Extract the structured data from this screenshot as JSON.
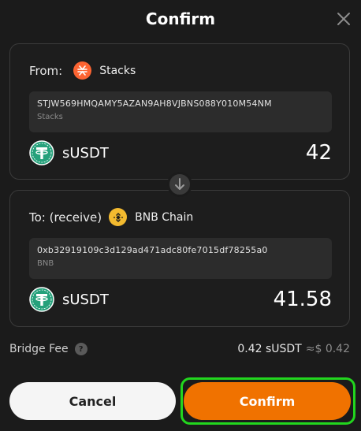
{
  "dialog": {
    "title": "Confirm"
  },
  "from": {
    "label": "From:",
    "chain": "Stacks",
    "chain_color": "#fc6432",
    "address": "STJW569HMQAMY5AZAN9AH8VJBNS088Y010M54NM",
    "network": "Stacks",
    "token": "sUSDT",
    "amount": "42"
  },
  "to": {
    "label": "To: (receive)",
    "chain": "BNB Chain",
    "chain_color": "#f3ba2f",
    "address": "0xb32919109c3d129ad471adc80fe7015df78255a0",
    "network": "BNB",
    "token": "sUSDT",
    "amount": "41.58"
  },
  "fee": {
    "label": "Bridge Fee",
    "help": "?",
    "value": "0.42 sUSDT",
    "approx": "≈$ 0.42"
  },
  "buttons": {
    "cancel": "Cancel",
    "confirm": "Confirm"
  },
  "colors": {
    "accent": "#f07200",
    "highlight": "#22d61e",
    "tether": "#26a17b"
  },
  "icons": {
    "close": "close-icon",
    "swap": "arrow-down-icon",
    "stacks": "stacks-icon",
    "bnb": "bnb-icon",
    "token": "tether-icon",
    "help": "question-icon"
  }
}
